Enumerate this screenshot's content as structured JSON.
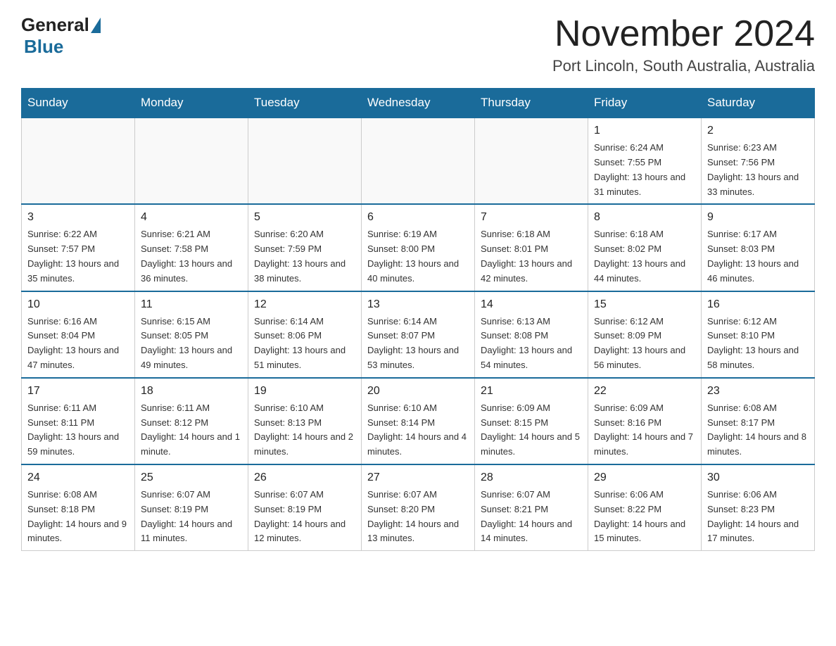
{
  "header": {
    "logo_general": "General",
    "logo_blue": "Blue",
    "month_title": "November 2024",
    "location": "Port Lincoln, South Australia, Australia"
  },
  "weekdays": [
    "Sunday",
    "Monday",
    "Tuesday",
    "Wednesday",
    "Thursday",
    "Friday",
    "Saturday"
  ],
  "weeks": [
    [
      {
        "day": "",
        "sunrise": "",
        "sunset": "",
        "daylight": ""
      },
      {
        "day": "",
        "sunrise": "",
        "sunset": "",
        "daylight": ""
      },
      {
        "day": "",
        "sunrise": "",
        "sunset": "",
        "daylight": ""
      },
      {
        "day": "",
        "sunrise": "",
        "sunset": "",
        "daylight": ""
      },
      {
        "day": "",
        "sunrise": "",
        "sunset": "",
        "daylight": ""
      },
      {
        "day": "1",
        "sunrise": "Sunrise: 6:24 AM",
        "sunset": "Sunset: 7:55 PM",
        "daylight": "Daylight: 13 hours and 31 minutes."
      },
      {
        "day": "2",
        "sunrise": "Sunrise: 6:23 AM",
        "sunset": "Sunset: 7:56 PM",
        "daylight": "Daylight: 13 hours and 33 minutes."
      }
    ],
    [
      {
        "day": "3",
        "sunrise": "Sunrise: 6:22 AM",
        "sunset": "Sunset: 7:57 PM",
        "daylight": "Daylight: 13 hours and 35 minutes."
      },
      {
        "day": "4",
        "sunrise": "Sunrise: 6:21 AM",
        "sunset": "Sunset: 7:58 PM",
        "daylight": "Daylight: 13 hours and 36 minutes."
      },
      {
        "day": "5",
        "sunrise": "Sunrise: 6:20 AM",
        "sunset": "Sunset: 7:59 PM",
        "daylight": "Daylight: 13 hours and 38 minutes."
      },
      {
        "day": "6",
        "sunrise": "Sunrise: 6:19 AM",
        "sunset": "Sunset: 8:00 PM",
        "daylight": "Daylight: 13 hours and 40 minutes."
      },
      {
        "day": "7",
        "sunrise": "Sunrise: 6:18 AM",
        "sunset": "Sunset: 8:01 PM",
        "daylight": "Daylight: 13 hours and 42 minutes."
      },
      {
        "day": "8",
        "sunrise": "Sunrise: 6:18 AM",
        "sunset": "Sunset: 8:02 PM",
        "daylight": "Daylight: 13 hours and 44 minutes."
      },
      {
        "day": "9",
        "sunrise": "Sunrise: 6:17 AM",
        "sunset": "Sunset: 8:03 PM",
        "daylight": "Daylight: 13 hours and 46 minutes."
      }
    ],
    [
      {
        "day": "10",
        "sunrise": "Sunrise: 6:16 AM",
        "sunset": "Sunset: 8:04 PM",
        "daylight": "Daylight: 13 hours and 47 minutes."
      },
      {
        "day": "11",
        "sunrise": "Sunrise: 6:15 AM",
        "sunset": "Sunset: 8:05 PM",
        "daylight": "Daylight: 13 hours and 49 minutes."
      },
      {
        "day": "12",
        "sunrise": "Sunrise: 6:14 AM",
        "sunset": "Sunset: 8:06 PM",
        "daylight": "Daylight: 13 hours and 51 minutes."
      },
      {
        "day": "13",
        "sunrise": "Sunrise: 6:14 AM",
        "sunset": "Sunset: 8:07 PM",
        "daylight": "Daylight: 13 hours and 53 minutes."
      },
      {
        "day": "14",
        "sunrise": "Sunrise: 6:13 AM",
        "sunset": "Sunset: 8:08 PM",
        "daylight": "Daylight: 13 hours and 54 minutes."
      },
      {
        "day": "15",
        "sunrise": "Sunrise: 6:12 AM",
        "sunset": "Sunset: 8:09 PM",
        "daylight": "Daylight: 13 hours and 56 minutes."
      },
      {
        "day": "16",
        "sunrise": "Sunrise: 6:12 AM",
        "sunset": "Sunset: 8:10 PM",
        "daylight": "Daylight: 13 hours and 58 minutes."
      }
    ],
    [
      {
        "day": "17",
        "sunrise": "Sunrise: 6:11 AM",
        "sunset": "Sunset: 8:11 PM",
        "daylight": "Daylight: 13 hours and 59 minutes."
      },
      {
        "day": "18",
        "sunrise": "Sunrise: 6:11 AM",
        "sunset": "Sunset: 8:12 PM",
        "daylight": "Daylight: 14 hours and 1 minute."
      },
      {
        "day": "19",
        "sunrise": "Sunrise: 6:10 AM",
        "sunset": "Sunset: 8:13 PM",
        "daylight": "Daylight: 14 hours and 2 minutes."
      },
      {
        "day": "20",
        "sunrise": "Sunrise: 6:10 AM",
        "sunset": "Sunset: 8:14 PM",
        "daylight": "Daylight: 14 hours and 4 minutes."
      },
      {
        "day": "21",
        "sunrise": "Sunrise: 6:09 AM",
        "sunset": "Sunset: 8:15 PM",
        "daylight": "Daylight: 14 hours and 5 minutes."
      },
      {
        "day": "22",
        "sunrise": "Sunrise: 6:09 AM",
        "sunset": "Sunset: 8:16 PM",
        "daylight": "Daylight: 14 hours and 7 minutes."
      },
      {
        "day": "23",
        "sunrise": "Sunrise: 6:08 AM",
        "sunset": "Sunset: 8:17 PM",
        "daylight": "Daylight: 14 hours and 8 minutes."
      }
    ],
    [
      {
        "day": "24",
        "sunrise": "Sunrise: 6:08 AM",
        "sunset": "Sunset: 8:18 PM",
        "daylight": "Daylight: 14 hours and 9 minutes."
      },
      {
        "day": "25",
        "sunrise": "Sunrise: 6:07 AM",
        "sunset": "Sunset: 8:19 PM",
        "daylight": "Daylight: 14 hours and 11 minutes."
      },
      {
        "day": "26",
        "sunrise": "Sunrise: 6:07 AM",
        "sunset": "Sunset: 8:19 PM",
        "daylight": "Daylight: 14 hours and 12 minutes."
      },
      {
        "day": "27",
        "sunrise": "Sunrise: 6:07 AM",
        "sunset": "Sunset: 8:20 PM",
        "daylight": "Daylight: 14 hours and 13 minutes."
      },
      {
        "day": "28",
        "sunrise": "Sunrise: 6:07 AM",
        "sunset": "Sunset: 8:21 PM",
        "daylight": "Daylight: 14 hours and 14 minutes."
      },
      {
        "day": "29",
        "sunrise": "Sunrise: 6:06 AM",
        "sunset": "Sunset: 8:22 PM",
        "daylight": "Daylight: 14 hours and 15 minutes."
      },
      {
        "day": "30",
        "sunrise": "Sunrise: 6:06 AM",
        "sunset": "Sunset: 8:23 PM",
        "daylight": "Daylight: 14 hours and 17 minutes."
      }
    ]
  ]
}
